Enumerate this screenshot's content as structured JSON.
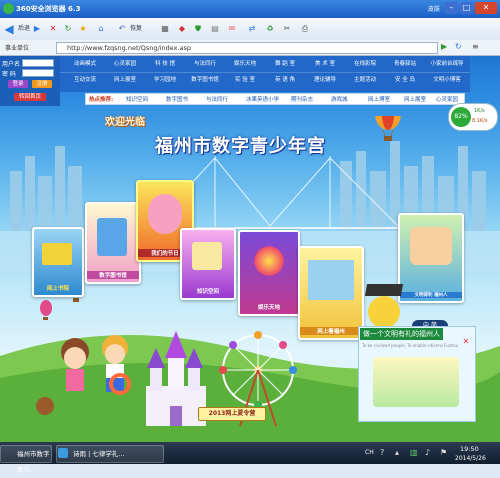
{
  "browser": {
    "title": "360安全浏览器 6.3",
    "skin_label": "皮肤",
    "back_label": "后退",
    "home_label": "恢复",
    "address_label": "事业单位",
    "url": "http://www.fzqsng.net/Qsng/index.asp"
  },
  "login": {
    "user_label": "用户名",
    "pass_label": "密 码",
    "login_btn": "登录",
    "register_btn": "注册",
    "back_btn": "转回首页"
  },
  "nav": {
    "row1": [
      "动画模式",
      "心灵家园",
      "科 技 馆",
      "与法同行",
      "娱乐天地",
      "舞 蹈 室",
      "美 术 室",
      "在线影院",
      "青春驿站",
      "小家前台疏导"
    ],
    "row2": [
      "互动交流",
      "网上展室",
      "学习园地",
      "数字图书馆",
      "实 验 室",
      "英 语 角",
      "理论辅导",
      "主题活动",
      "安 全 岛",
      "文明小博客"
    ],
    "hot_label": "热点推荐:",
    "hot_links": [
      "知识空间",
      "数字图书",
      "与法同行",
      "冰果英语小学",
      "期刊杂志",
      "游戏城",
      "网上博室",
      "网上展室",
      "心灵家园"
    ]
  },
  "speed": {
    "percent": "82%",
    "up": "1K/s",
    "down": "8.1K/s"
  },
  "banner": {
    "welcome": "欢迎光临",
    "title": "福州市数字青少年宫"
  },
  "cards": [
    {
      "label": "网上书院"
    },
    {
      "label": "数字图书馆"
    },
    {
      "label": "我们的节日"
    },
    {
      "label": "知识空间"
    },
    {
      "label": "娱乐天地"
    },
    {
      "label": "网上看福州"
    },
    {
      "label": "文明得利 福州人"
    },
    {
      "label": "2013网上夏令营"
    }
  ],
  "float_label": "中 简",
  "popup": {
    "title": "做一个文明有礼的福州人",
    "sub": "To be civilized people, To enable citizens Fuzhou"
  },
  "taskbar": {
    "tasks": [
      "福州市数字青少...",
      "诗雨 | 七律学礼..."
    ],
    "time": "19:50",
    "date": "2014/5/26",
    "lang": "CH"
  }
}
